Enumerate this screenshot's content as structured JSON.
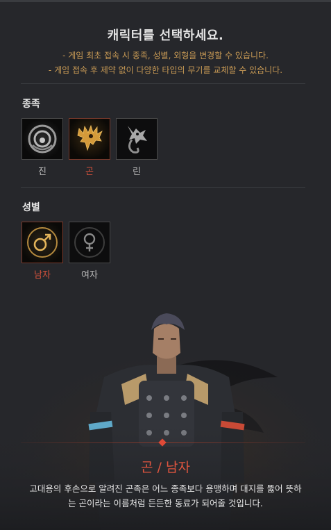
{
  "header": {
    "title": "캐릭터를 선택하세요.",
    "notes": [
      "- 게임 최초 접속 시 종족, 성별, 외형을 변경할 수 있습니다.",
      "- 게임 접속 후 제약 없이 다양한 타입의 무기를 교체할 수 있습니다."
    ]
  },
  "race": {
    "label": "종족",
    "options": [
      {
        "label": "진",
        "icon": "jin-emblem-icon",
        "selected": false
      },
      {
        "label": "곤",
        "icon": "gon-dragon-emblem-icon",
        "selected": true
      },
      {
        "label": "린",
        "icon": "lyn-fox-emblem-icon",
        "selected": false
      }
    ]
  },
  "gender": {
    "label": "성별",
    "options": [
      {
        "label": "남자",
        "icon": "male-symbol-icon",
        "selected": true
      },
      {
        "label": "여자",
        "icon": "female-symbol-icon",
        "selected": false
      }
    ]
  },
  "selection": {
    "title": "곤 / 남자",
    "description_lines": [
      "고대용의 후손으로 알려진 곤족은 어느 종족보다 용맹하며 대지를 뚫어 뜻하",
      "는 곤이라는 이름처럼 든든한 동료가 되어줄 것입니다."
    ]
  },
  "colors": {
    "accent": "#d9533c",
    "note_text": "#c89a55",
    "panel_bg": "#26272b"
  }
}
